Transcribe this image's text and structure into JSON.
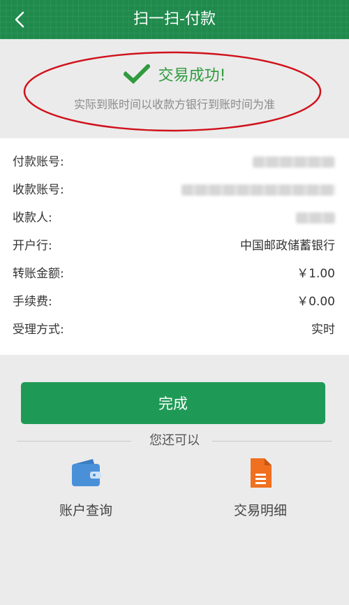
{
  "header": {
    "title": "扫一扫-付款",
    "back_icon": "chevron-left-icon"
  },
  "status": {
    "title": "交易成功!",
    "note": "实际到账时间以收款方银行到账时间为准",
    "icon": "checkmark-icon",
    "highlight_color": "#d0121b",
    "success_color": "#2f9b3e"
  },
  "details": {
    "rows": [
      {
        "label": "付款账号:",
        "value": ""
      },
      {
        "label": "收款账号:",
        "value": ""
      },
      {
        "label": "收款人:",
        "value": ""
      },
      {
        "label": "开户行:",
        "value": "中国邮政储蓄银行"
      },
      {
        "label": "转账金额:",
        "value": "￥1.00"
      },
      {
        "label": "手续费:",
        "value": "￥0.00"
      },
      {
        "label": "受理方式:",
        "value": "实时"
      }
    ]
  },
  "actions": {
    "done_label": "完成",
    "more_label": "您还可以",
    "items": [
      {
        "label": "账户查询",
        "icon": "wallet-icon"
      },
      {
        "label": "交易明细",
        "icon": "document-icon"
      }
    ]
  },
  "colors": {
    "primary": "#1f9a56",
    "header": "#1f8a4c"
  }
}
